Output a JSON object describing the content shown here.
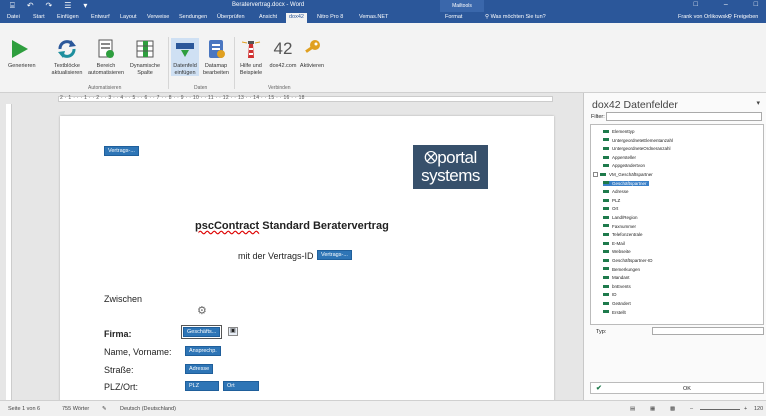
{
  "titlebar": {
    "qat": [
      "⌸",
      "↶",
      "↷",
      "☰",
      "▾"
    ],
    "doc_title": "Beratervertrag.docx - Word",
    "context_tools": "Mailtools",
    "winctl": [
      "□",
      "–",
      "□"
    ]
  },
  "tabs": {
    "items": [
      "Datei",
      "Start",
      "Einfügen",
      "Entwurf",
      "Layout",
      "Verweise",
      "Sendungen",
      "Überprüfen",
      "Ansicht",
      "dox42",
      "Nitro Pro 8",
      "Vemas.NET",
      "Format"
    ],
    "active": "dox42",
    "tell_me": "Was möchten Sie tun?",
    "user": "Frank von Orlikowski",
    "share": "Freigeben"
  },
  "ribbon": {
    "buttons": [
      {
        "id": "generieren",
        "label1": "Generieren",
        "label2": "",
        "icon": "play-icon"
      },
      {
        "id": "textbloecke",
        "label1": "Textblöcke",
        "label2": "aktualisieren",
        "icon": "refresh-icon"
      },
      {
        "id": "bereich",
        "label1": "Bereich",
        "label2": "automatisieren",
        "icon": "gear-doc-icon"
      },
      {
        "id": "dynspalte",
        "label1": "Dynamische",
        "label2": "Spalte",
        "icon": "table-column-icon"
      },
      {
        "id": "datenfeld",
        "label1": "Datenfeld",
        "label2": "einfügen",
        "icon": "datafield-icon"
      },
      {
        "id": "datamap",
        "label1": "Datamap",
        "label2": "bearbeiten",
        "icon": "datamap-icon"
      },
      {
        "id": "hilfe",
        "label1": "Hilfe und",
        "label2": "Beispiele",
        "icon": "lighthouse-icon"
      },
      {
        "id": "dox42com",
        "label1": "dox42.com",
        "label2": "",
        "icon": "dox42-logo-icon"
      },
      {
        "id": "aktivieren",
        "label1": "Aktivieren",
        "label2": "",
        "icon": "key-icon"
      }
    ],
    "groups": [
      "Automatisieren",
      "Daten",
      "Verbinden"
    ]
  },
  "ruler": {
    "numbers": "2 · 1 · · · 1 · · 2 · · 3 · · 4 · · 5 · · 6 · · 7 · · 8 · · 9 · · 10 · · 11 · · 12 · · 13 · · 14 · · 15 · · 16 · · 18"
  },
  "document": {
    "top_field": "Vertrags-...",
    "logo_line1": "⭙portal",
    "logo_line2": "systems",
    "heading_underlined": "pscContract",
    "heading_rest": " Standard Beratervertrag",
    "id_text": "mit der Vertrags-ID",
    "id_field": "Vertrags-...",
    "zwischen": "Zwischen",
    "anchor_icon": "⚙",
    "firma_label": "Firma:",
    "firma_field": "Geschäfts...",
    "name_label": "Name, Vorname:",
    "name_field": "Ansprechp.",
    "strasse_label": "Straße:",
    "strasse_field": "Adresse",
    "plz_label": "PLZ/Ort:",
    "plz_field": "PLZ",
    "ort_field": "Ort"
  },
  "pane": {
    "title": "dox42 Datenfelder",
    "close": "▾",
    "filter_label": "Filter:",
    "tree_items": [
      {
        "label": "Elementtyp",
        "level": 1
      },
      {
        "label": "UntergeordneteElementanzahl",
        "level": 1
      },
      {
        "label": "UntergeordneteOrdneranzahl",
        "level": 1
      },
      {
        "label": "Appersteller",
        "level": 1
      },
      {
        "label": "Appgeändertvon",
        "level": 1
      },
      {
        "label": "VM_Geschäftspartner",
        "level": 0
      },
      {
        "label": "Geschäftspartner",
        "level": 1,
        "selected": true
      },
      {
        "label": "Adresse",
        "level": 1
      },
      {
        "label": "PLZ",
        "level": 1
      },
      {
        "label": "Ort",
        "level": 1
      },
      {
        "label": "Land/Region",
        "level": 1
      },
      {
        "label": "Faxnummer",
        "level": 1
      },
      {
        "label": "Telefonzentrale",
        "level": 1
      },
      {
        "label": "E-Mail",
        "level": 1
      },
      {
        "label": "Webseite",
        "level": 1
      },
      {
        "label": "Geschäftspartner-ID",
        "level": 1
      },
      {
        "label": "Bemerkungen",
        "level": 1
      },
      {
        "label": "Mandant",
        "level": 1
      },
      {
        "label": "bnEvents",
        "level": 1
      },
      {
        "label": "ID",
        "level": 1
      },
      {
        "label": "Geändert",
        "level": 1
      },
      {
        "label": "Erstellt",
        "level": 1
      }
    ],
    "typ_label": "Typ:",
    "ok": "OK",
    "check": "✔"
  },
  "status": {
    "page": "Seite 1 von 6",
    "words": "755 Wörter",
    "lang": "Deutsch (Deutschland)",
    "zoom": "120"
  }
}
